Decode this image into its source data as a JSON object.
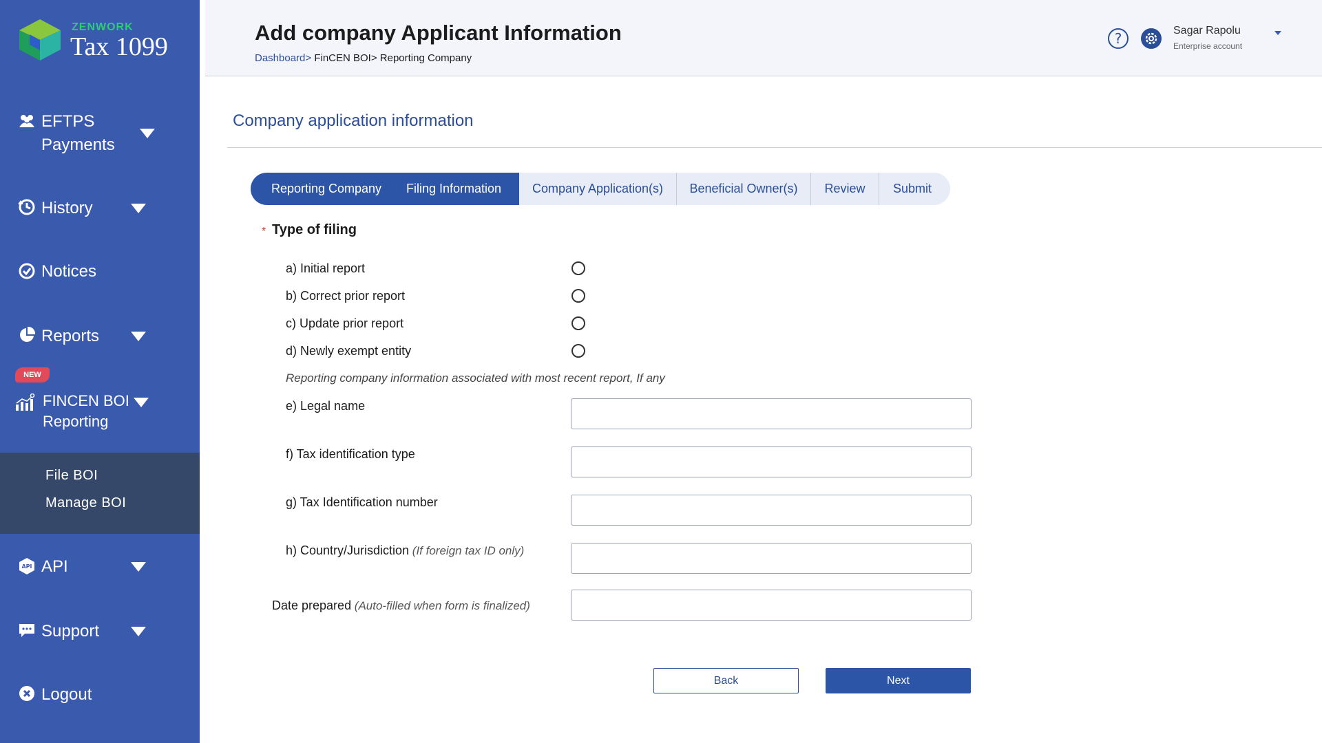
{
  "brand": {
    "company": "ZENWORK",
    "product": "Tax 1099"
  },
  "sidebar": {
    "items": [
      {
        "label_line1": "EFTPS",
        "label_line2": "Payments",
        "icon": "people-icon",
        "has_caret": true
      },
      {
        "label": "History",
        "icon": "history-icon",
        "has_caret": true
      },
      {
        "label": "Notices",
        "icon": "notices-icon",
        "has_caret": false
      },
      {
        "label": "Reports",
        "icon": "pie-chart-icon",
        "has_caret": true
      },
      {
        "label_line1": "FINCEN BOI",
        "label_line2": "Reporting",
        "icon": "bar-chart-icon",
        "has_caret": true,
        "badge": "NEW"
      },
      {
        "label": "API",
        "icon": "api-icon",
        "has_caret": true
      },
      {
        "label": "Support",
        "icon": "chat-icon",
        "has_caret": true
      },
      {
        "label": "Logout",
        "icon": "logout-icon",
        "has_caret": false
      }
    ],
    "submenu": [
      "File BOI",
      "Manage BOI"
    ]
  },
  "header": {
    "title": "Add company Applicant Information",
    "breadcrumb": {
      "link": "Dashboard>",
      "rest": " FinCEN BOI> Reporting Company"
    },
    "user": {
      "name": "Sagar Rapolu",
      "role": "Enterprise account"
    }
  },
  "main": {
    "section_title": "Company application information",
    "steps": [
      {
        "label": "Reporting Company",
        "active": true
      },
      {
        "label": "Filing Information",
        "active": true
      },
      {
        "label": "Company Application(s)",
        "active": false
      },
      {
        "label": "Beneficial Owner(s)",
        "active": false
      },
      {
        "label": "Review",
        "active": false
      },
      {
        "label": "Submit",
        "active": false
      }
    ],
    "required_mark": "*",
    "filing_type_title": "Type of filing",
    "filing_options": [
      "a) Initial report",
      "b) Correct prior report",
      "c) Update prior report",
      "d) Newly exempt entity"
    ],
    "note": "Reporting company information associated with most recent report, If any",
    "fields": [
      {
        "label": "e) Legal name",
        "hint": "",
        "value": ""
      },
      {
        "label": "f) Tax identification type",
        "hint": "",
        "value": ""
      },
      {
        "label": "g) Tax Identification number",
        "hint": "",
        "value": ""
      },
      {
        "label": "h) Country/Jurisdiction",
        "hint": " (If foreign tax ID only)",
        "value": ""
      },
      {
        "label": "Date prepared",
        "hint": " (Auto-filled when form is finalized)",
        "value": ""
      }
    ],
    "buttons": {
      "back": "Back",
      "next": "Next"
    }
  },
  "colors": {
    "sidebar": "#3a5aad",
    "submenu": "#364869",
    "accent": "#2c55a8",
    "badge": "#e24a5a",
    "brand_green": "#2ecc71"
  }
}
